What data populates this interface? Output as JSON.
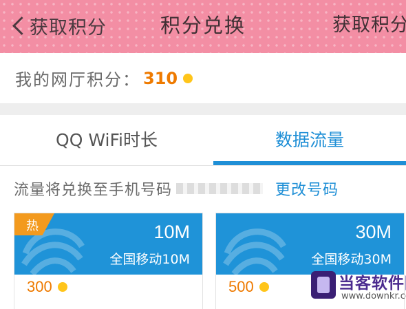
{
  "header": {
    "back_label": "获取积分",
    "title": "积分兑换",
    "right_label": "获取积分"
  },
  "points": {
    "label": "我的网厅积分：",
    "value": "310"
  },
  "tabs": [
    {
      "label": "QQ WiFi时长",
      "active": false
    },
    {
      "label": "数据流量",
      "active": true
    }
  ],
  "notice": {
    "text": "流量将兑换至手机号码",
    "change_link": "更改号码"
  },
  "cards": [
    {
      "size": "10M",
      "desc": "全国移动10M",
      "cost": "300",
      "badge": "热"
    },
    {
      "size": "30M",
      "desc": "全国移动30M",
      "cost": "500"
    }
  ],
  "watermark": {
    "name": "当客软件园",
    "url": "www.downkr.com"
  },
  "colors": {
    "header_pink": "#f38ea4",
    "accent_blue": "#1f8fd6",
    "card_blue": "#1f93d8",
    "points_orange": "#ee7a00",
    "hot_orange": "#f39a1e",
    "coin_yellow": "#ffc51a"
  }
}
